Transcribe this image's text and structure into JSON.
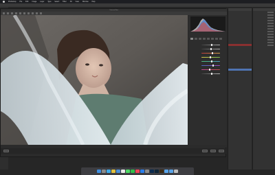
{
  "menubar": {
    "items": [
      "Photoshop",
      "File",
      "Edit",
      "Image",
      "Layer",
      "Type",
      "Select",
      "Filter",
      "3D",
      "View",
      "Window",
      "Help"
    ],
    "right": [
      "",
      ""
    ]
  },
  "dialog": {
    "title": "Camera Raw",
    "status_left": "",
    "status_center": "",
    "buttons": {
      "save": "",
      "open": "",
      "cancel": "",
      "done": ""
    },
    "link": ""
  },
  "adjust": {
    "info_left": "",
    "info_right": "",
    "sliders": [
      {
        "label": "",
        "value": "",
        "level": 0.52,
        "colors": [
          "#3a3a3a",
          "#b8b8b8"
        ]
      },
      {
        "label": "",
        "value": "",
        "level": 0.48,
        "colors": [
          "#3a3a3a",
          "#b8b8b8"
        ]
      },
      {
        "label": "",
        "value": "",
        "level": 0.55,
        "colors": [
          "#c23a3a",
          "#d9a44a"
        ]
      },
      {
        "label": "",
        "value": "",
        "level": 0.45,
        "colors": [
          "#d9c84a",
          "#7ec24a"
        ]
      },
      {
        "label": "",
        "value": "",
        "level": 0.5,
        "colors": [
          "#4ac27e",
          "#4a9ec2"
        ]
      },
      {
        "label": "",
        "value": "",
        "level": 0.6,
        "colors": [
          "#4a6ac2",
          "#9a4ac2"
        ]
      },
      {
        "label": "",
        "value": "",
        "level": 0.4,
        "colors": [
          "#c24a9a",
          "#c24a4a"
        ]
      },
      {
        "label": "",
        "value": "",
        "level": 0.5,
        "colors": [
          "#3a3a3a",
          "#b8b8b8"
        ]
      }
    ]
  },
  "ps_right1": {
    "header": "",
    "history": [
      {
        "text": "",
        "state": ""
      },
      {
        "text": "",
        "state": ""
      },
      {
        "text": "",
        "state": ""
      },
      {
        "text": "",
        "state": ""
      },
      {
        "text": "",
        "state": ""
      },
      {
        "text": "",
        "state": ""
      },
      {
        "text": "",
        "state": ""
      },
      {
        "text": "",
        "state": ""
      },
      {
        "text": "",
        "state": ""
      },
      {
        "text": "",
        "state": ""
      },
      {
        "text": "",
        "state": ""
      },
      {
        "text": "",
        "state": ""
      },
      {
        "text": "",
        "state": ""
      },
      {
        "text": "",
        "state": ""
      },
      {
        "text": "",
        "state": ""
      },
      {
        "text": "",
        "state": ""
      },
      {
        "text": "",
        "state": "red"
      },
      {
        "text": "",
        "state": ""
      },
      {
        "text": "",
        "state": ""
      },
      {
        "text": "",
        "state": ""
      },
      {
        "text": "",
        "state": ""
      },
      {
        "text": "",
        "state": ""
      },
      {
        "text": "",
        "state": ""
      },
      {
        "text": "",
        "state": ""
      },
      {
        "text": "",
        "state": ""
      },
      {
        "text": "",
        "state": ""
      },
      {
        "text": "",
        "state": ""
      },
      {
        "text": "",
        "state": ""
      },
      {
        "text": "",
        "state": "sel"
      }
    ]
  },
  "ps_right2": {
    "header": "",
    "rows": [
      "",
      "",
      "",
      "",
      "",
      "",
      "",
      "",
      "",
      "",
      "",
      "",
      ""
    ]
  },
  "dock": {
    "icons": [
      {
        "name": "finder-icon",
        "color": "#3f8fe0"
      },
      {
        "name": "launchpad-icon",
        "color": "#8a8a8a"
      },
      {
        "name": "safari-icon",
        "color": "#3fa9e8"
      },
      {
        "name": "chrome-icon",
        "color": "#e0c03f"
      },
      {
        "name": "mail-icon",
        "color": "#4a90d9"
      },
      {
        "name": "photos-icon",
        "color": "#e8e8e8"
      },
      {
        "name": "messages-icon",
        "color": "#4cd964"
      },
      {
        "name": "facetime-icon",
        "color": "#2fbf4a"
      },
      {
        "name": "music-icon",
        "color": "#f0445a"
      },
      {
        "name": "app-store-icon",
        "color": "#2b7de9"
      },
      {
        "name": "settings-icon",
        "color": "#8c8c8c"
      },
      {
        "name": "photoshop-icon",
        "color": "#0b2a4f"
      },
      {
        "name": "lightroom-icon",
        "color": "#0d2437"
      },
      {
        "name": "bridge-icon",
        "color": "#3b2a14"
      },
      {
        "name": "folder-icon",
        "color": "#5aa4e8"
      },
      {
        "name": "downloads-icon",
        "color": "#5aa4e8"
      },
      {
        "name": "trash-icon",
        "color": "#bdbdbd"
      }
    ]
  },
  "colors": {
    "accent": "#4f74b3",
    "panel_bg": "#2d2d2d",
    "menubar_bg": "#1d1e22"
  }
}
